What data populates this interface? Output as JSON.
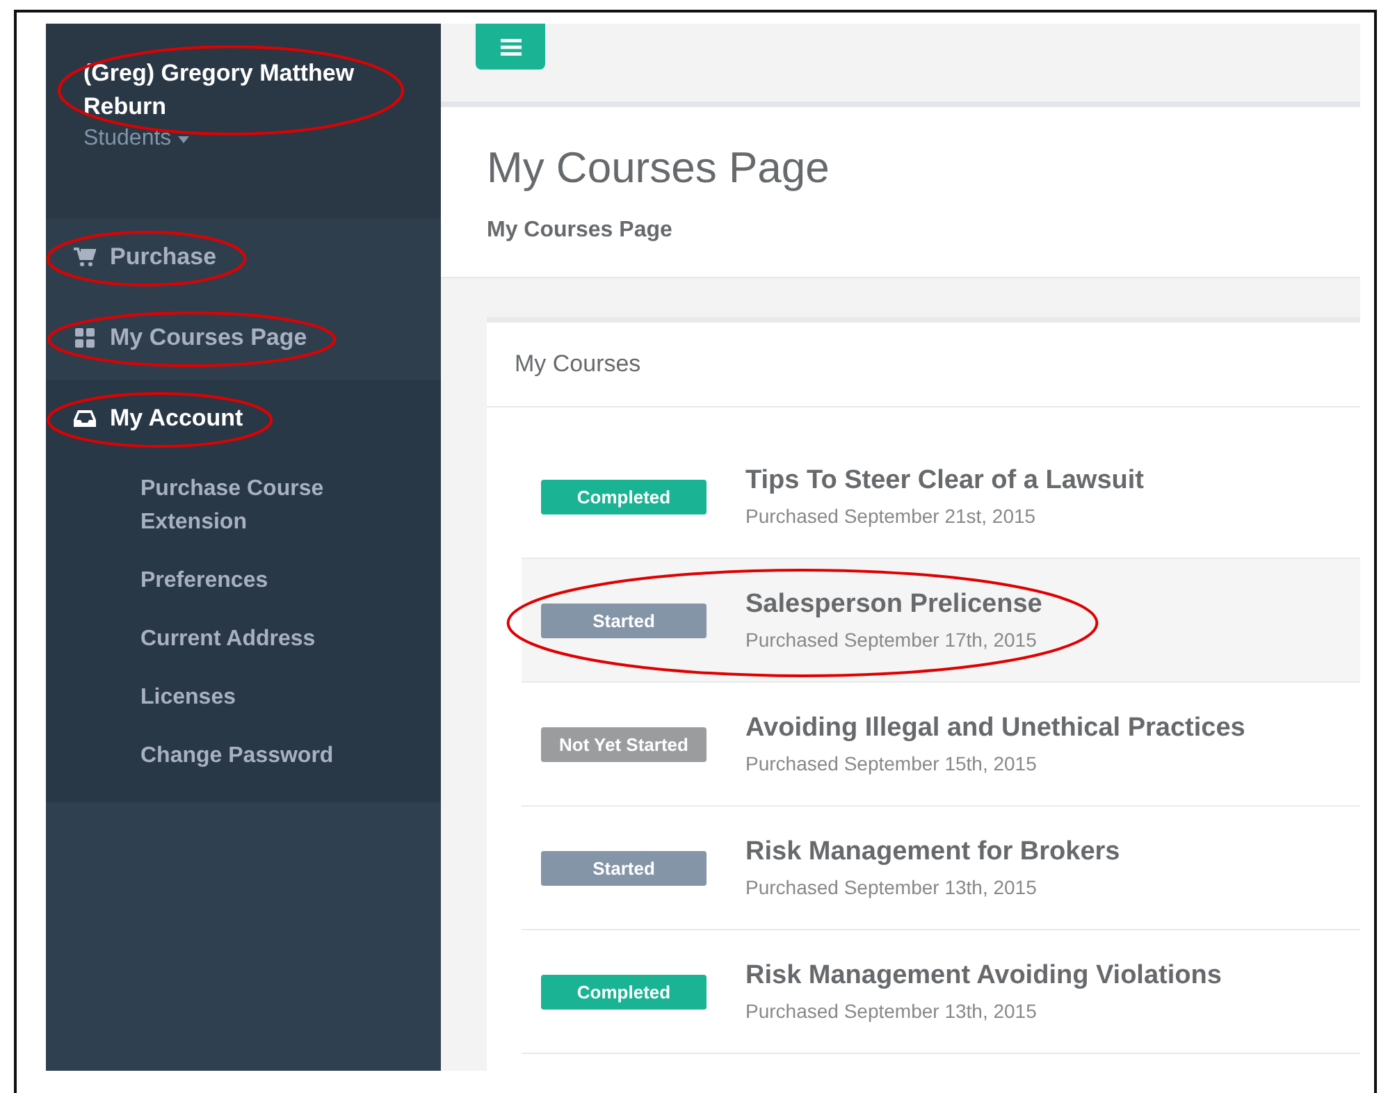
{
  "profile": {
    "name": "(Greg) Gregory Matthew Reburn",
    "role": "Students",
    "circled": true
  },
  "nav": [
    {
      "label": "Purchase",
      "kind": "cart",
      "active": false,
      "circled": true
    },
    {
      "label": "My Courses Page",
      "kind": "grid",
      "active": false,
      "circled": true
    },
    {
      "label": "My Account",
      "kind": "inbox",
      "active": true,
      "circled": true,
      "children": [
        {
          "label": "Purchase Course Extension"
        },
        {
          "label": "Preferences"
        },
        {
          "label": "Current Address"
        },
        {
          "label": "Licenses"
        },
        {
          "label": "Change Password"
        }
      ]
    }
  ],
  "page": {
    "title": "My Courses Page",
    "breadcrumb": "My Courses Page"
  },
  "panel": {
    "title": "My Courses"
  },
  "courses": [
    {
      "status": "Completed",
      "kind": "completed",
      "title": "Tips To Steer Clear of a Lawsuit",
      "purchased": "Purchased September 21st, 2015",
      "highlighted": false,
      "circled": false
    },
    {
      "status": "Started",
      "kind": "started",
      "title": "Salesperson Prelicense",
      "purchased": "Purchased September 17th, 2015",
      "highlighted": true,
      "circled": true
    },
    {
      "status": "Not Yet Started",
      "kind": "not_started",
      "title": "Avoiding Illegal and Unethical Practices",
      "purchased": "Purchased September 15th, 2015",
      "highlighted": false,
      "circled": false
    },
    {
      "status": "Started",
      "kind": "started",
      "title": "Risk Management for Brokers",
      "purchased": "Purchased September 13th, 2015",
      "highlighted": false,
      "circled": false
    },
    {
      "status": "Completed",
      "kind": "completed",
      "title": "Risk Management Avoiding Violations",
      "purchased": "Purchased September 13th, 2015",
      "highlighted": false,
      "circled": false
    }
  ]
}
